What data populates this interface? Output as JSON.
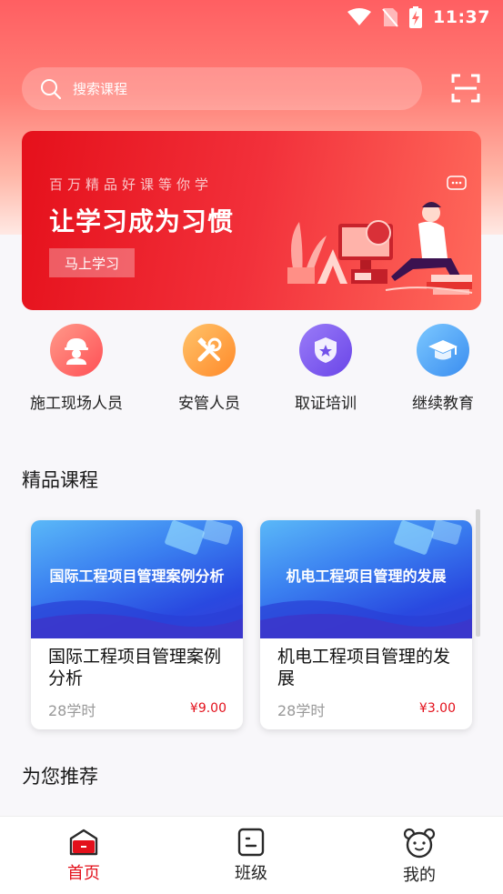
{
  "status_bar": {
    "time": "11:37"
  },
  "search": {
    "placeholder": "搜索课程"
  },
  "banner": {
    "subtitle": "百万精品好课等你学",
    "title": "让学习成为习惯",
    "button_label": "马上学习"
  },
  "categories": [
    {
      "label": "施工现场人员",
      "icon": "worker-helmet-icon",
      "color": "#ff6a6a"
    },
    {
      "label": "安管人员",
      "icon": "tools-icon",
      "color": "#ffa040"
    },
    {
      "label": "取证培训",
      "icon": "shield-star-icon",
      "color": "#7b5cf0"
    },
    {
      "label": "继续教育",
      "icon": "graduation-cap-icon",
      "color": "#4aa6f5"
    }
  ],
  "featured": {
    "title": "精品课程",
    "courses": [
      {
        "thumb_text": "国际工程项目管理案例分析",
        "name": "国际工程项目管理案例分析",
        "hours": "28学时",
        "price": "¥9.00"
      },
      {
        "thumb_text": "机电工程项目管理的发展",
        "name": "机电工程项目管理的发展",
        "hours": "28学时",
        "price": "¥3.00"
      }
    ]
  },
  "recommend": {
    "title": "为您推荐"
  },
  "bottom_nav": [
    {
      "label": "首页",
      "icon": "home-icon",
      "active": true
    },
    {
      "label": "班级",
      "icon": "class-icon",
      "active": false
    },
    {
      "label": "我的",
      "icon": "profile-bear-icon",
      "active": false
    }
  ],
  "colors": {
    "accent": "#e3101b",
    "header_gradient_top": "#ff5f62"
  }
}
